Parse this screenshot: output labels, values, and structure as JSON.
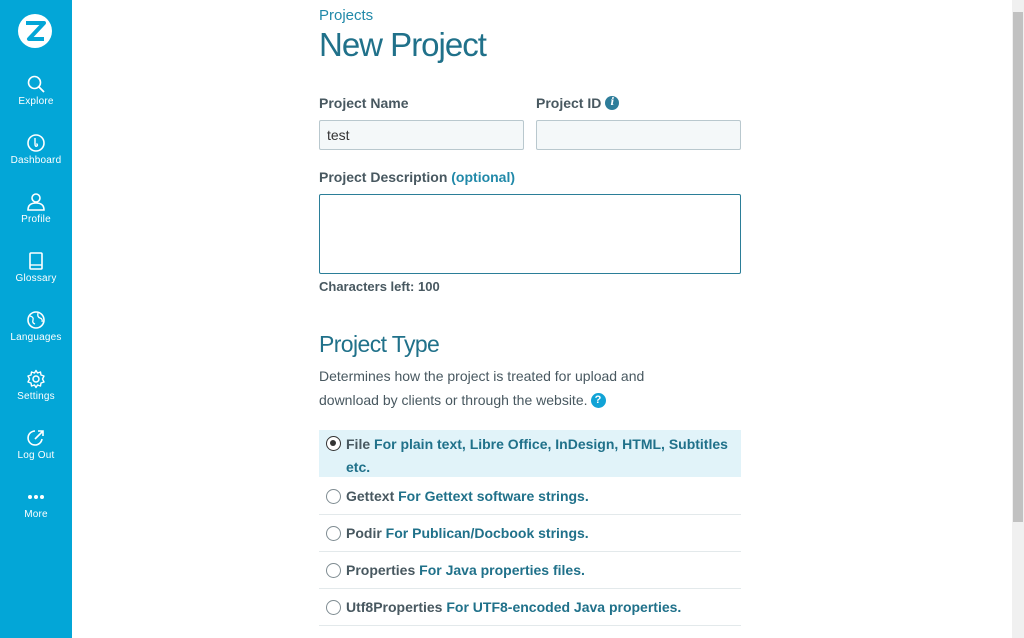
{
  "sidebar": {
    "items": [
      {
        "label": "Explore",
        "icon": "search-icon"
      },
      {
        "label": "Dashboard",
        "icon": "dashboard-icon"
      },
      {
        "label": "Profile",
        "icon": "user-icon"
      },
      {
        "label": "Glossary",
        "icon": "book-icon"
      },
      {
        "label": "Languages",
        "icon": "globe-icon"
      },
      {
        "label": "Settings",
        "icon": "gear-icon"
      },
      {
        "label": "Log Out",
        "icon": "logout-icon"
      },
      {
        "label": "More",
        "icon": "more-icon"
      }
    ],
    "color": "#03a6d7"
  },
  "breadcrumb": "Projects",
  "page_title": "New Project",
  "form": {
    "project_name_label": "Project Name",
    "project_name_value": "test",
    "project_id_label": "Project ID",
    "project_id_value": "",
    "description_label": "Project Description",
    "description_optional": "(optional)",
    "description_value": "",
    "chars_left": "Characters left: 100"
  },
  "project_type": {
    "title": "Project Type",
    "description": "Determines how the project is treated for upload and download by clients or through the website.",
    "options": [
      {
        "name": "File",
        "desc": "For plain text, Libre Office, InDesign, HTML, Subtitles etc.",
        "selected": true
      },
      {
        "name": "Gettext",
        "desc": "For Gettext software strings.",
        "selected": false
      },
      {
        "name": "Podir",
        "desc": "For Publican/Docbook strings.",
        "selected": false
      },
      {
        "name": "Properties",
        "desc": "For Java properties files.",
        "selected": false
      },
      {
        "name": "Utf8Properties",
        "desc": "For UTF8-encoded Java properties.",
        "selected": false
      }
    ]
  },
  "colors": {
    "accent": "#20718a",
    "link": "#2189a9",
    "selected_bg": "#e1f3f9"
  }
}
